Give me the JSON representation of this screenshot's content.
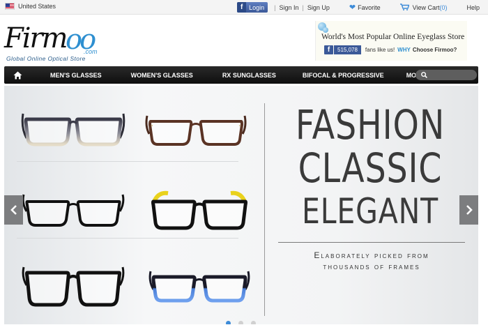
{
  "topbar": {
    "country": "United States",
    "facebook_login": "Login",
    "sign_in": "Sign In",
    "sign_up": "Sign Up",
    "favorite": "Favorite",
    "view_cart": "View Cart",
    "cart_count": "(0)",
    "help": "Help",
    "separator": "|"
  },
  "logo": {
    "word": "Firm",
    "oo": "oo",
    "com": ".com",
    "tagline": "Global Online Optical Store"
  },
  "promo": {
    "title": "World's Most Popular Online Eyeglass Store",
    "fb_count": "515,078",
    "fans_text": "fans like us!",
    "why": "WHY",
    "choose": "Choose Firmoo?"
  },
  "nav": {
    "items": [
      "MEN'S GLASSES",
      "WOMEN'S GLASSES",
      "RX SUNGLASSES",
      "BIFOCAL & PROGRESSIVE",
      "MORE"
    ],
    "search_placeholder": ""
  },
  "banner": {
    "headline": [
      "FASHION",
      "CLASSIC",
      "ELEGANT"
    ],
    "subline": [
      "Elaborately picked from",
      "thousands of frames"
    ],
    "slides": 3,
    "active_slide": 1
  },
  "colors": {
    "accent": "#3d8bd8",
    "facebook": "#3b5998",
    "nav_bg": "#1a1a1a",
    "logo_blue": "#2e8fd0"
  }
}
